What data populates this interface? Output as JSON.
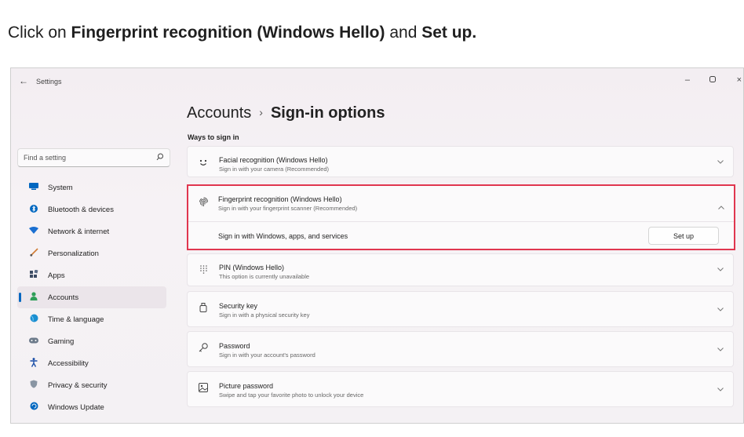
{
  "instruction": {
    "prefix": "Click on ",
    "item": "Fingerprint recognition (Windows Hello)",
    "middle": " and ",
    "action": "Set up."
  },
  "window": {
    "title": "Settings",
    "back_glyph": "←",
    "minimize_glyph": "–",
    "restore_glyph": "▫",
    "close_glyph": "×"
  },
  "header": {
    "breadcrumb_parent": "Accounts",
    "breadcrumb_separator": "›",
    "breadcrumb_current": "Sign-in options"
  },
  "section_label": "Ways to sign in",
  "search": {
    "placeholder": "Find a setting",
    "icon": "search-icon"
  },
  "sidebar": {
    "items": [
      {
        "label": "System",
        "icon": "system-icon",
        "color": "#0067c0"
      },
      {
        "label": "Bluetooth & devices",
        "icon": "bluetooth-icon",
        "color": "#0067c0"
      },
      {
        "label": "Network & internet",
        "icon": "network-icon",
        "color": "#1b6fd1"
      },
      {
        "label": "Personalization",
        "icon": "brush-icon",
        "color": "#d07a32"
      },
      {
        "label": "Apps",
        "icon": "apps-icon",
        "color": "#3c4b63"
      },
      {
        "label": "Accounts",
        "icon": "accounts-icon",
        "color": "#2e9e58",
        "active": true
      },
      {
        "label": "Time & language",
        "icon": "globe-icon",
        "color": "#1b8fd1"
      },
      {
        "label": "Gaming",
        "icon": "gaming-icon",
        "color": "#6c7a8a"
      },
      {
        "label": "Accessibility",
        "icon": "accessibility-icon",
        "color": "#1b4fa8"
      },
      {
        "label": "Privacy & security",
        "icon": "shield-icon",
        "color": "#6c7a8a"
      },
      {
        "label": "Windows Update",
        "icon": "update-icon",
        "color": "#0067c0"
      }
    ]
  },
  "options": {
    "facial": {
      "title": "Facial recognition (Windows Hello)",
      "subtitle": "Sign in with your camera (Recommended)",
      "icon": "face-icon"
    },
    "fingerprint": {
      "title": "Fingerprint recognition (Windows Hello)",
      "subtitle": "Sign in with your fingerprint scanner (Recommended)",
      "icon": "fingerprint-icon",
      "detail": "Sign in with Windows, apps, and services",
      "button": "Set up"
    },
    "pin": {
      "title": "PIN (Windows Hello)",
      "subtitle": "This option is currently unavailable",
      "icon": "keypad-icon"
    },
    "security_key": {
      "title": "Security key",
      "subtitle": "Sign in with a physical security key",
      "icon": "usb-key-icon"
    },
    "password": {
      "title": "Password",
      "subtitle": "Sign in with your account's password",
      "icon": "key-icon"
    },
    "picture_password": {
      "title": "Picture password",
      "subtitle": "Swipe and tap your favorite photo to unlock your device",
      "icon": "picture-icon"
    }
  },
  "colors": {
    "accent": "#0067c0",
    "highlight_border": "#e0364f"
  }
}
